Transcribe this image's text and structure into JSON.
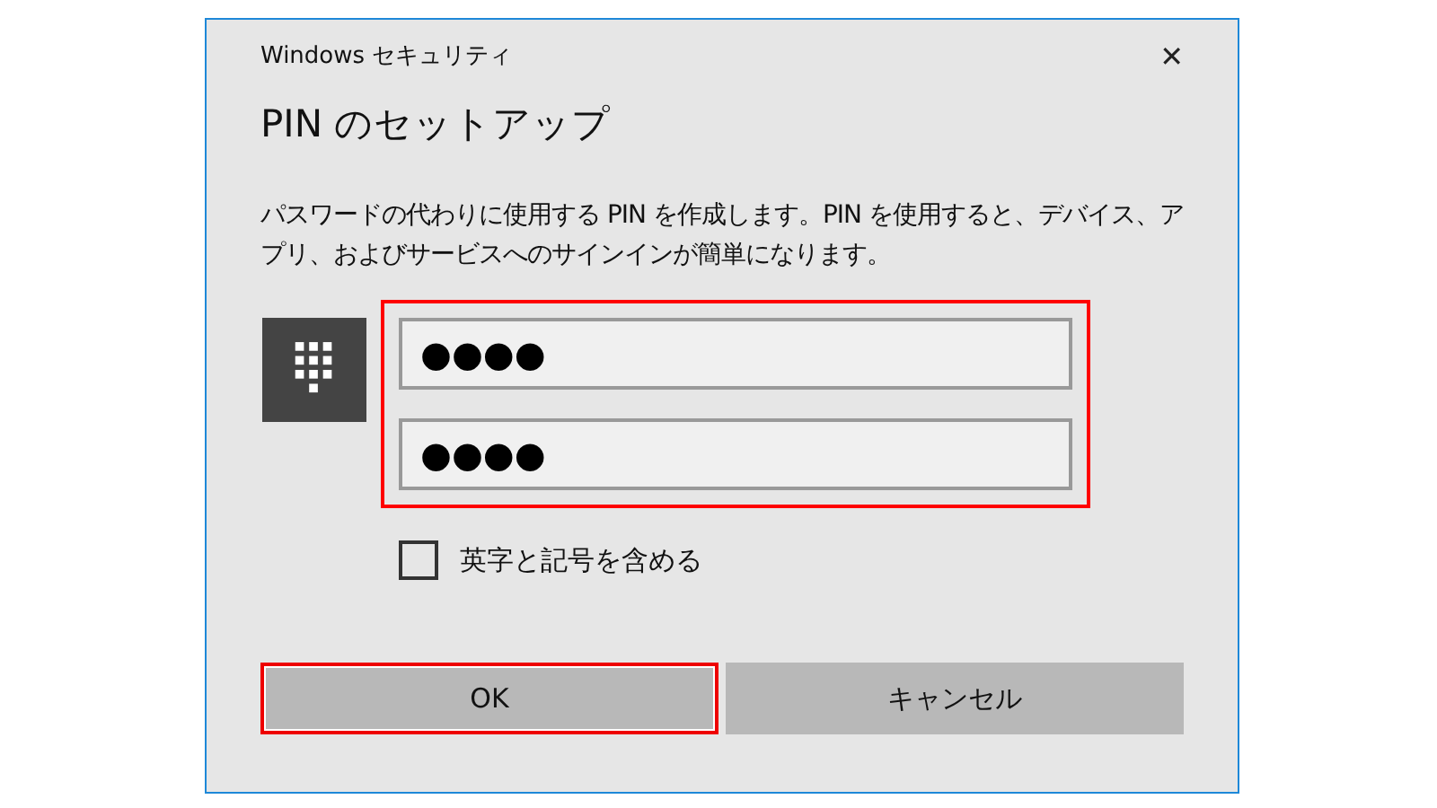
{
  "window": {
    "title": "Windows セキュリティ",
    "close": "✕"
  },
  "heading": "PIN のセットアップ",
  "description": "パスワードの代わりに使用する PIN を作成します。PIN を使用すると、デバイス、アプリ、およびサービスへのサインインが簡単になります。",
  "pin_fields": {
    "highlighted": true,
    "fields": [
      {
        "value": "●●●●"
      },
      {
        "value": "●●●●"
      }
    ]
  },
  "checkbox": {
    "label": "英字と記号を含める",
    "checked": false
  },
  "buttons": [
    {
      "label": "OK",
      "highlighted": true,
      "focused": true
    },
    {
      "label": "キャンセル",
      "highlighted": false,
      "focused": false
    }
  ]
}
